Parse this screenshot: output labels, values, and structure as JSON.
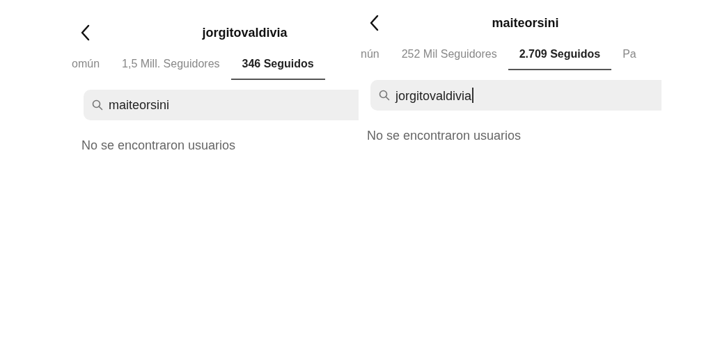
{
  "panels": [
    {
      "title": "jorgitovaldivia",
      "tabs": [
        {
          "label": "omún",
          "selected": false
        },
        {
          "label": "1,5 Mill. Seguidores",
          "selected": false
        },
        {
          "label": "346 Seguidos",
          "selected": true
        }
      ],
      "search": {
        "value": "maiteorsini",
        "cursor": false
      },
      "empty_message": "No se encontraron usuarios"
    },
    {
      "title": "maiteorsini",
      "tabs": [
        {
          "label": "nún",
          "selected": false
        },
        {
          "label": "252 Mil Seguidores",
          "selected": false
        },
        {
          "label": "2.709 Seguidos",
          "selected": true
        },
        {
          "label": "Pa",
          "selected": false
        }
      ],
      "search": {
        "value": "jorgitovaldivia",
        "cursor": true
      },
      "empty_message": "No se encontraron usuarios"
    }
  ]
}
